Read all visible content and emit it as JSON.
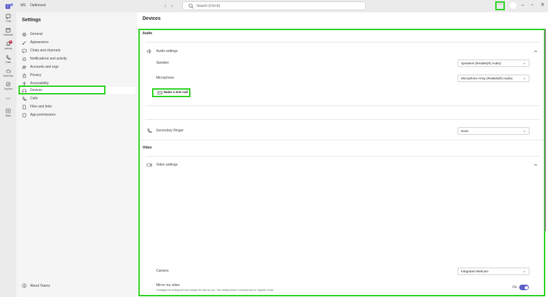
{
  "titlebar": {
    "org_short": "MS",
    "org_name": "Optimized",
    "nav_back": "‹",
    "nav_forward": "›",
    "search_placeholder": "Search (Ctrl+E)",
    "more_label": "···",
    "minimize": "–",
    "maximize": "▫",
    "close": "✕"
  },
  "rail": [
    {
      "label": "Chat",
      "icon": "chat-icon"
    },
    {
      "label": "Calendar",
      "icon": "calendar-icon"
    },
    {
      "label": "Activity",
      "icon": "bell-icon",
      "badge": "1"
    },
    {
      "label": "Calls",
      "icon": "phone-icon"
    },
    {
      "label": "OneDrive",
      "icon": "cloud-icon"
    },
    {
      "label": "Explore",
      "icon": "compass-icon"
    },
    {
      "label": "",
      "icon": "more-icon"
    },
    {
      "label": "Apps",
      "icon": "apps-icon"
    }
  ],
  "sidebar": {
    "title": "Settings",
    "items": [
      {
        "label": "General",
        "icon": "gear-icon"
      },
      {
        "label": "Appearance",
        "icon": "brush-icon"
      },
      {
        "label": "Chats and channels",
        "icon": "chat-bubble-icon"
      },
      {
        "label": "Notifications and activity",
        "icon": "bell-icon"
      },
      {
        "label": "Accounts and orgs",
        "icon": "people-icon"
      },
      {
        "label": "Privacy",
        "icon": "lock-icon"
      },
      {
        "label": "Accessibility",
        "icon": "accessibility-icon"
      },
      {
        "label": "Devices",
        "icon": "headset-icon"
      },
      {
        "label": "Calls",
        "icon": "phone-icon"
      },
      {
        "label": "Files and links",
        "icon": "file-icon"
      },
      {
        "label": "App permissions",
        "icon": "shield-icon"
      }
    ],
    "active_index": 7,
    "about": "About Teams"
  },
  "main": {
    "title": "Devices",
    "audio": {
      "heading": "Audio",
      "audio_settings_label": "Audio settings",
      "speaker_label": "Speaker",
      "speaker_value": "Speakers (Realtek(R) Audio)",
      "microphone_label": "Microphone",
      "microphone_value": "Microphone Array (Realtek(R) Audio)",
      "test_call_label": "Make a test call",
      "secondary_ringer_label": "Secondary Ringer",
      "secondary_ringer_value": "None"
    },
    "video": {
      "heading": "Video",
      "video_settings_label": "Video settings",
      "camera_label": "Camera",
      "camera_value": "Integrated Webcam",
      "mirror_label": "Mirror my video",
      "mirror_desc": "Changing this setting will only change the view for you. This setting doesn't currently work in Together mode.",
      "mirror_state": "On"
    }
  },
  "colors": {
    "highlight": "#26d21a",
    "accent": "#5b5fc7"
  }
}
